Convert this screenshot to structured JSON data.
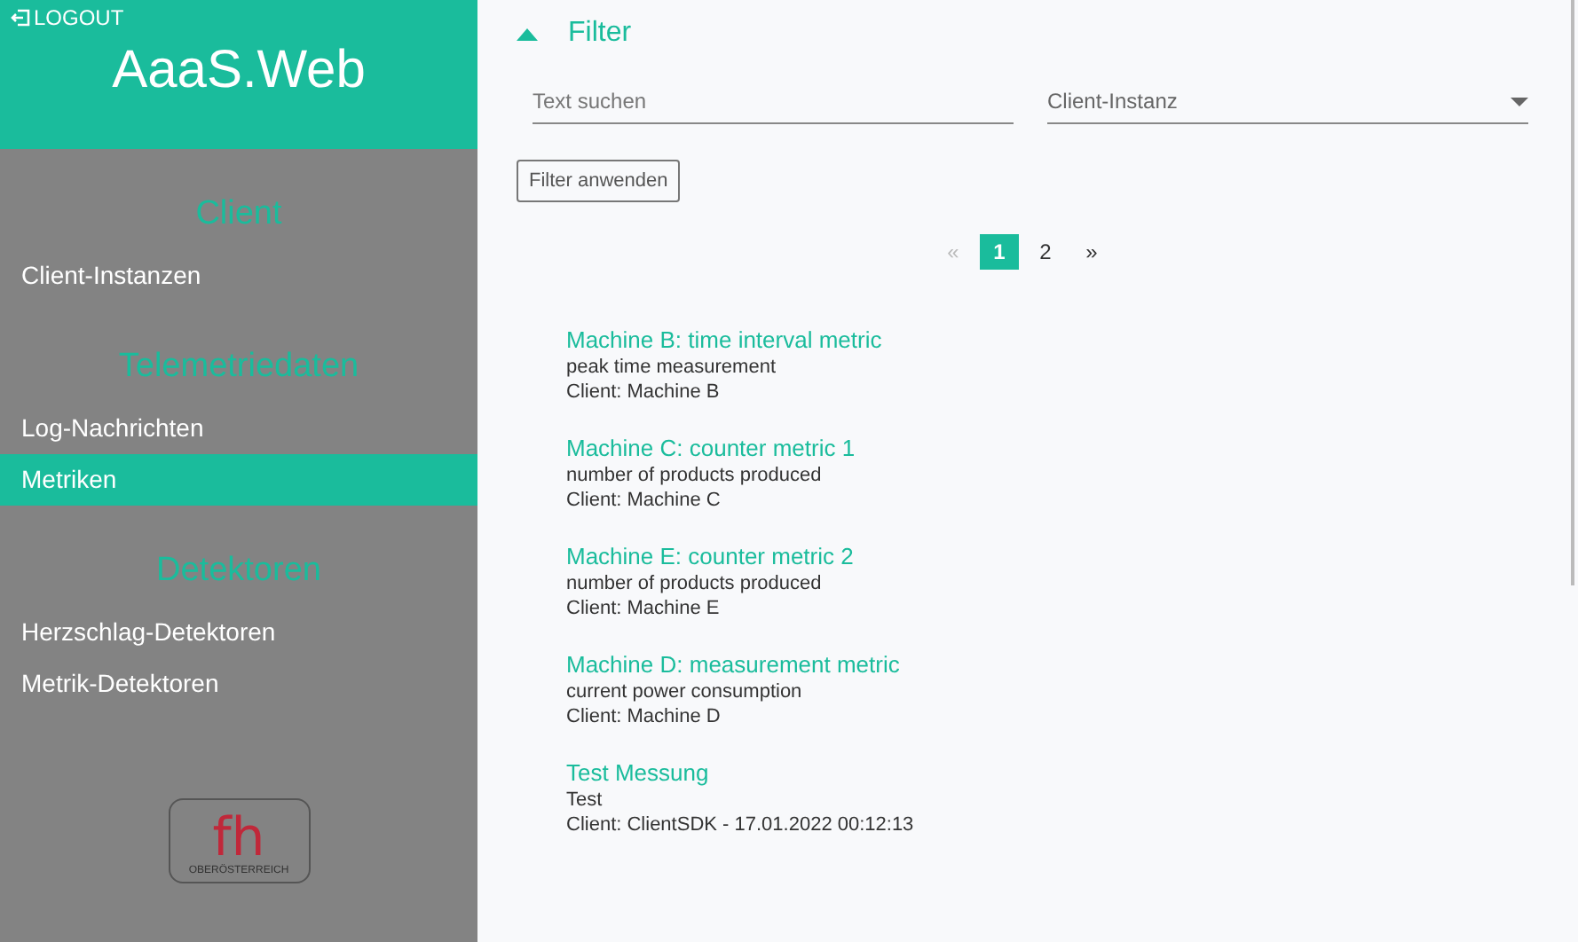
{
  "sidebar": {
    "logout": "LOGOUT",
    "title": "AaaS.Web",
    "sections": [
      {
        "heading": "Client",
        "items": [
          {
            "label": "Client-Instanzen",
            "selected": false
          }
        ]
      },
      {
        "heading": "Telemetriedaten",
        "items": [
          {
            "label": "Log-Nachrichten",
            "selected": false
          },
          {
            "label": "Metriken",
            "selected": true
          }
        ]
      },
      {
        "heading": "Detektoren",
        "items": [
          {
            "label": "Herzschlag-Detektoren",
            "selected": false
          },
          {
            "label": "Metrik-Detektoren",
            "selected": false
          }
        ]
      }
    ],
    "logo": {
      "letters": "fh",
      "region": "OBERÖSTERREICH"
    }
  },
  "filter": {
    "title": "Filter",
    "expanded": true,
    "search": {
      "placeholder": "Text suchen"
    },
    "client_select": {
      "placeholder": "Client-Instanz"
    },
    "apply_button": "Filter anwenden"
  },
  "pagination": {
    "prev": "«",
    "next": "»",
    "pages": [
      {
        "label": "1",
        "selected": true
      },
      {
        "label": "2",
        "selected": false
      }
    ]
  },
  "metrics": [
    {
      "title": "Machine B: time interval metric",
      "description": "peak time measurement",
      "client": "Client: Machine B"
    },
    {
      "title": "Machine C: counter metric 1",
      "description": "number of products produced",
      "client": "Client: Machine C"
    },
    {
      "title": "Machine E: counter metric 2",
      "description": "number of products produced",
      "client": "Client: Machine E"
    },
    {
      "title": "Machine D: measurement metric",
      "description": "current power consumption",
      "client": "Client: Machine D"
    },
    {
      "title": "Test Messung",
      "description": "Test",
      "client": "Client: ClientSDK - 17.01.2022 00:12:13"
    }
  ]
}
